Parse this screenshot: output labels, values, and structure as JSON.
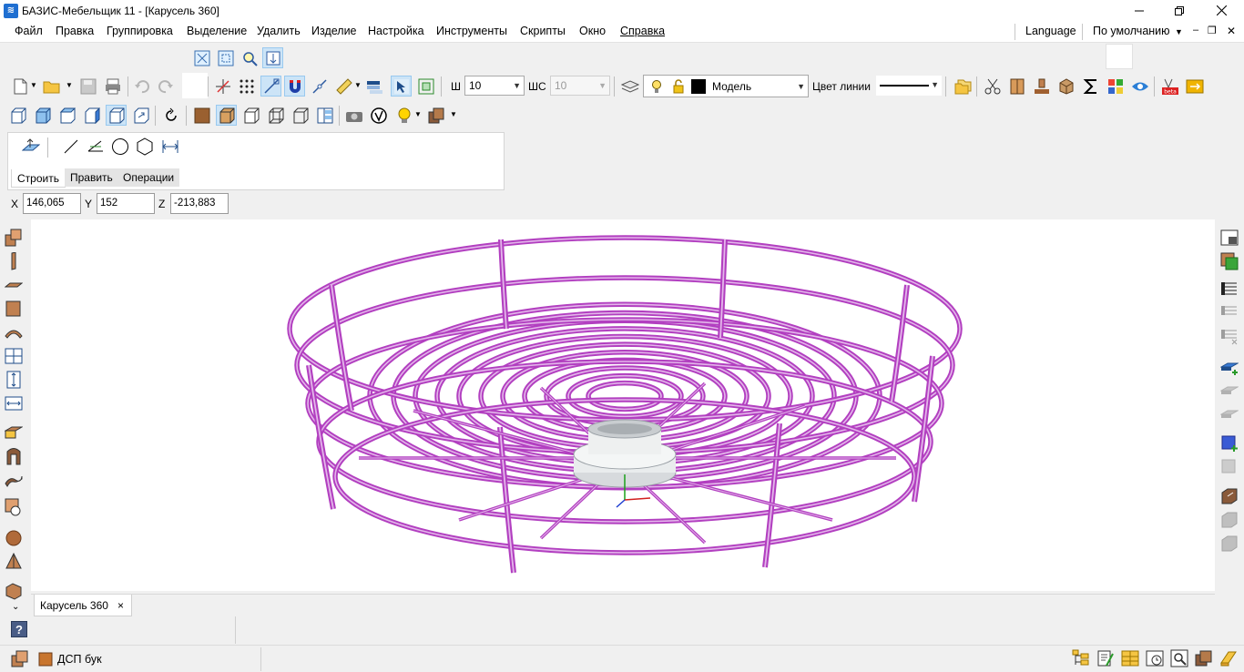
{
  "window": {
    "title": "БАЗИС-Мебельщик 11 - [Карусель 360]",
    "app_icon_text": "≋"
  },
  "menu": {
    "items": [
      "Файл",
      "Правка",
      "Группировка",
      "Выделение",
      "Удалить",
      "Изделие",
      "Настройка",
      "Инструменты",
      "Скрипты",
      "Окно",
      "Справка"
    ],
    "language": "Language",
    "profile": "По умолчанию"
  },
  "toolbar": {
    "w_label": "Ш",
    "w_value": "10",
    "ws_label": "ШС",
    "ws_value": "10",
    "layer_value": "Модель",
    "line_color_label": "Цвет линии"
  },
  "build_panel": {
    "tabs": [
      "Строить",
      "Править",
      "Операции"
    ],
    "active_tab": "Строить"
  },
  "coords": {
    "x_label": "X",
    "x_value": "146,065",
    "y_label": "Y",
    "y_value": "152",
    "z_label": "Z",
    "z_value": "-213,883"
  },
  "document_tab": {
    "label": "Карусель 360",
    "close": "×"
  },
  "status": {
    "help_icon": "?",
    "material": "ДСП бук"
  },
  "colors": {
    "wire": "#b23fc0",
    "wire_highlight": "#e3b6ea",
    "accent": "#0078d7"
  }
}
